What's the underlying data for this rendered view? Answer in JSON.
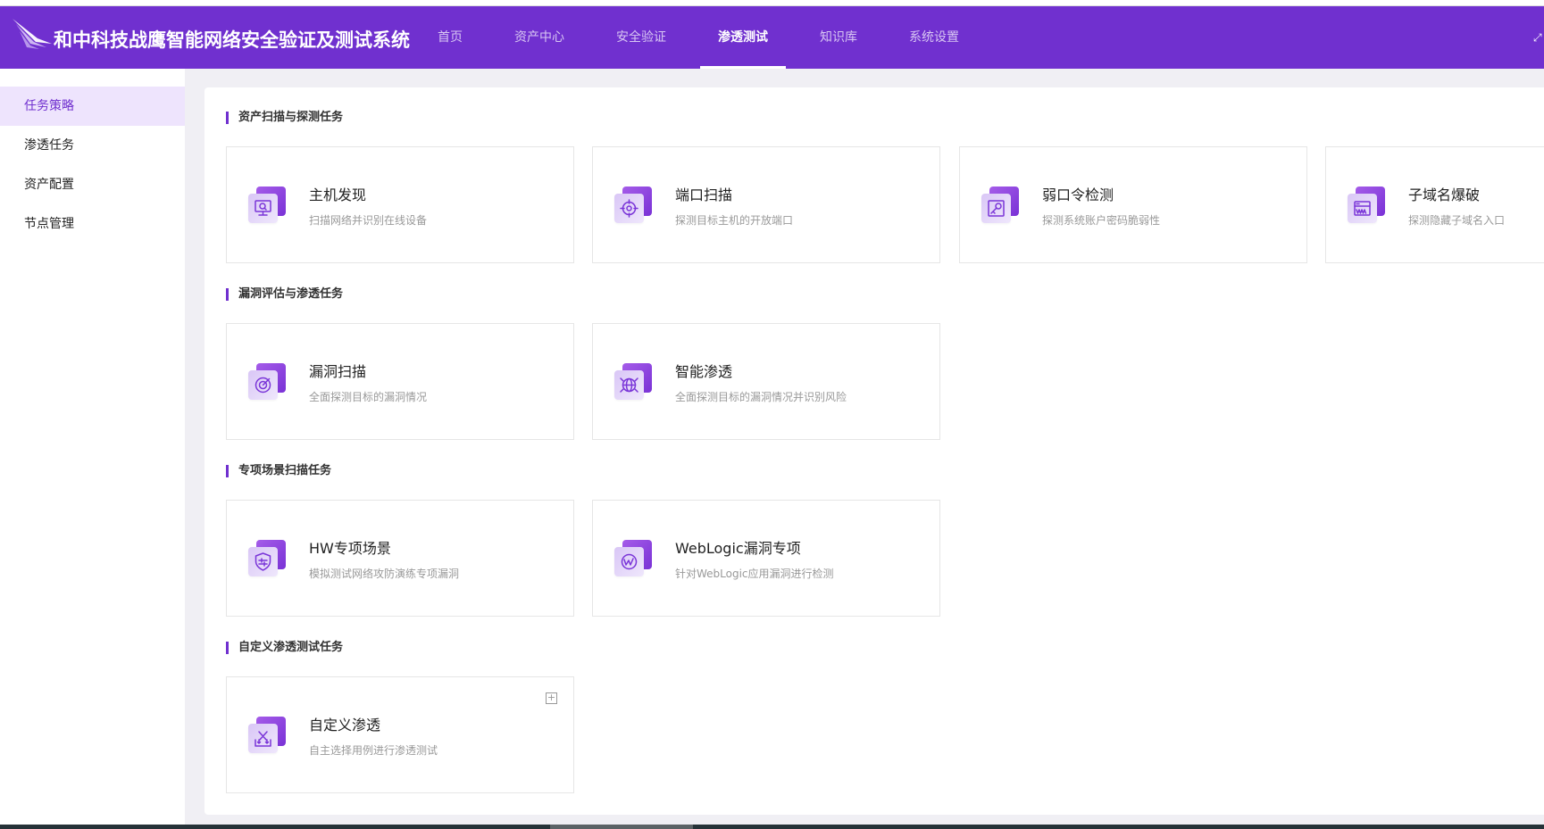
{
  "header": {
    "title": "和中科技战鹰智能网络安全验证及测试系统",
    "brand_color": "#7030cf",
    "nav": [
      {
        "label": "首页"
      },
      {
        "label": "资产中心"
      },
      {
        "label": "安全验证"
      },
      {
        "label": "渗透测试",
        "active": true
      },
      {
        "label": "知识库"
      },
      {
        "label": "系统设置"
      }
    ]
  },
  "sidebar": {
    "items": [
      {
        "label": "任务策略",
        "active": true
      },
      {
        "label": "渗透任务"
      },
      {
        "label": "资产配置"
      },
      {
        "label": "节点管理"
      }
    ]
  },
  "sections": [
    {
      "title": "资产扫描与探测任务",
      "cards": [
        {
          "name": "主机发现",
          "desc": "扫描网络并识别在线设备",
          "icon": "monitor-search-icon"
        },
        {
          "name": "端口扫描",
          "desc": "探测目标主机的开放端口",
          "icon": "port-scan-icon"
        },
        {
          "name": "弱口令检测",
          "desc": "探测系统账户密码脆弱性",
          "icon": "key-icon"
        },
        {
          "name": "子域名爆破",
          "desc": "探测隐藏子域名入口",
          "icon": "www-icon"
        }
      ]
    },
    {
      "title": "漏洞评估与渗透任务",
      "cards": [
        {
          "name": "漏洞扫描",
          "desc": "全面探测目标的漏洞情况",
          "icon": "target-icon"
        },
        {
          "name": "智能渗透",
          "desc": "全面探测目标的漏洞情况并识别风险",
          "icon": "globe-icon"
        }
      ]
    },
    {
      "title": "专项场景扫描任务",
      "cards": [
        {
          "name": "HW专项场景",
          "desc": "模拟测试网络攻防演练专项漏洞",
          "icon": "shield-icon"
        },
        {
          "name": "WebLogic漏洞专项",
          "desc": "针对WebLogic应用漏洞进行检测",
          "icon": "weblogic-icon"
        }
      ]
    },
    {
      "title": "自定义渗透测试任务",
      "cards": [
        {
          "name": "自定义渗透",
          "desc": "自主选择用例进行渗透测试",
          "icon": "custom-swords-icon"
        }
      ]
    }
  ]
}
